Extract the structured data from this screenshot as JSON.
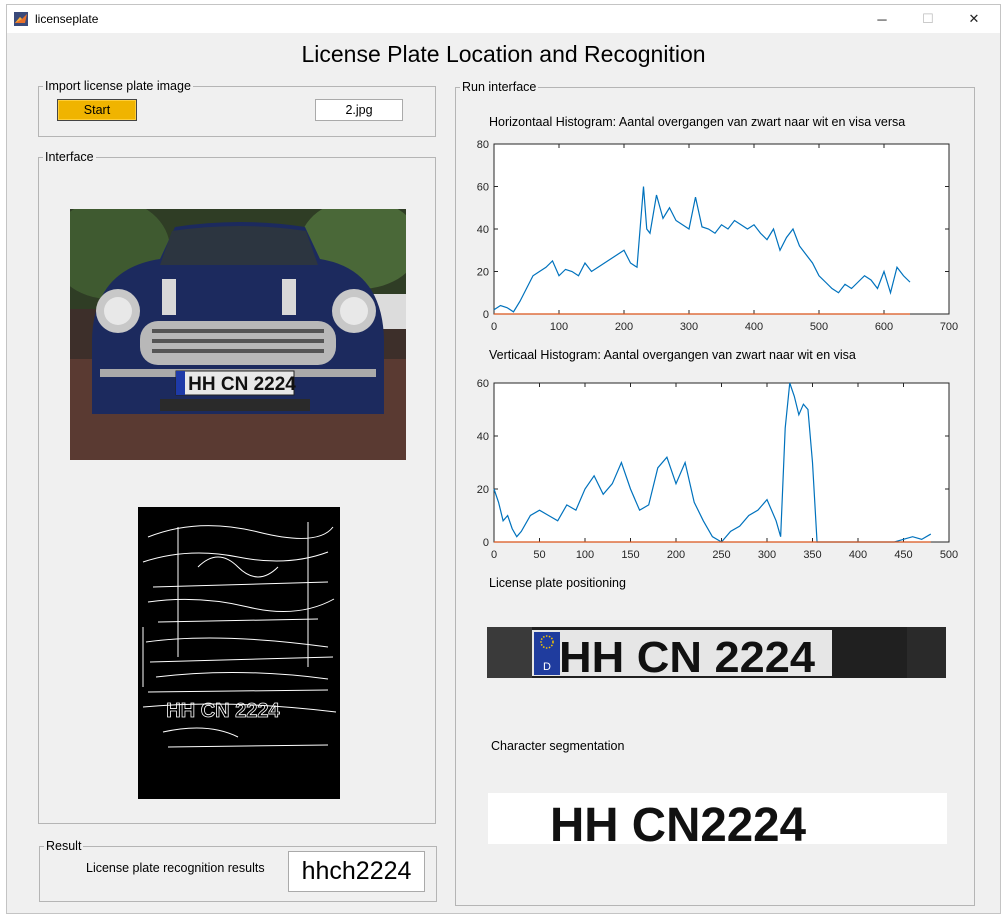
{
  "window": {
    "title": "licenseplate",
    "controls": {
      "minimize": "─",
      "maximize": "☐",
      "close": "✕"
    }
  },
  "main_title": "License Plate Location and Recognition",
  "import_panel": {
    "legend": "Import license plate image",
    "start_label": "Start",
    "file_name": "2.jpg"
  },
  "interface_panel": {
    "legend": "Interface"
  },
  "result_panel": {
    "legend": "Result",
    "label": "License plate recognition results",
    "value": "hhch2224"
  },
  "run_panel": {
    "legend": "Run interface"
  },
  "histograms": {
    "horizontal_title": "Horizontaal Histogram: Aantal overgangen van zwart naar wit en visa versa",
    "vertical_title": "Verticaal Histogram: Aantal overgangen van zwart naar wit en visa"
  },
  "plate_positioning": {
    "title": "License plate positioning",
    "plate_text": "HH CN 2224",
    "country": "D"
  },
  "segmentation": {
    "title": "Character segmentation",
    "text": "HH CN2224"
  },
  "car_photo": {
    "plate_text": "HH CN 2224"
  },
  "edge_image": {
    "plate_text": "HH CN 2224"
  },
  "colors": {
    "accent": "#f0b400",
    "line": "#0072bd",
    "baseline": "#d95319"
  },
  "chart_data": [
    {
      "type": "line",
      "title": "Horizontaal Histogram: Aantal overgangen van zwart naar wit en visa versa",
      "xlim": [
        0,
        700
      ],
      "ylim": [
        0,
        80
      ],
      "xticks": [
        0,
        100,
        200,
        300,
        400,
        500,
        600,
        700
      ],
      "yticks": [
        0,
        20,
        40,
        60,
        80
      ],
      "series": [
        {
          "x": [
            0,
            10,
            20,
            30,
            40,
            50,
            60,
            70,
            80,
            90,
            100,
            110,
            120,
            130,
            140,
            150,
            160,
            170,
            180,
            190,
            200,
            210,
            220,
            230,
            235,
            240,
            250,
            260,
            270,
            280,
            290,
            300,
            310,
            320,
            330,
            340,
            350,
            360,
            370,
            380,
            390,
            400,
            410,
            420,
            430,
            440,
            450,
            460,
            470,
            480,
            490,
            500,
            510,
            520,
            530,
            540,
            550,
            560,
            570,
            580,
            590,
            600,
            610,
            620,
            630,
            640
          ],
          "y": [
            2,
            4,
            3,
            1,
            6,
            12,
            18,
            20,
            22,
            25,
            18,
            21,
            20,
            18,
            24,
            20,
            22,
            24,
            26,
            28,
            30,
            24,
            22,
            60,
            40,
            38,
            56,
            45,
            50,
            44,
            42,
            40,
            55,
            41,
            40,
            38,
            42,
            40,
            44,
            42,
            40,
            42,
            38,
            35,
            40,
            30,
            36,
            40,
            32,
            28,
            24,
            18,
            15,
            12,
            10,
            14,
            12,
            15,
            18,
            16,
            12,
            20,
            10,
            22,
            18,
            15
          ]
        },
        {
          "x": [
            0,
            640
          ],
          "y": [
            0,
            0
          ]
        }
      ]
    },
    {
      "type": "line",
      "title": "Verticaal Histogram: Aantal overgangen van zwart naar wit en visa",
      "xlim": [
        0,
        500
      ],
      "ylim": [
        0,
        60
      ],
      "xticks": [
        0,
        50,
        100,
        150,
        200,
        250,
        300,
        350,
        400,
        450,
        500
      ],
      "yticks": [
        0,
        20,
        40,
        60
      ],
      "series": [
        {
          "x": [
            0,
            5,
            10,
            15,
            20,
            25,
            30,
            40,
            50,
            60,
            70,
            80,
            90,
            100,
            110,
            120,
            130,
            140,
            150,
            160,
            170,
            180,
            190,
            200,
            210,
            220,
            230,
            240,
            250,
            260,
            270,
            280,
            290,
            300,
            310,
            315,
            320,
            325,
            330,
            335,
            340,
            345,
            350,
            355,
            360,
            400,
            440,
            450,
            460,
            470,
            480
          ],
          "y": [
            20,
            15,
            8,
            10,
            5,
            2,
            4,
            10,
            12,
            10,
            8,
            14,
            12,
            20,
            25,
            18,
            22,
            30,
            20,
            12,
            14,
            28,
            32,
            22,
            30,
            15,
            8,
            2,
            0,
            4,
            6,
            10,
            12,
            16,
            8,
            2,
            43,
            60,
            55,
            48,
            52,
            50,
            30,
            0,
            0,
            0,
            0,
            1,
            2,
            1,
            3
          ]
        },
        {
          "x": [
            0,
            480
          ],
          "y": [
            0,
            0
          ]
        }
      ]
    }
  ]
}
